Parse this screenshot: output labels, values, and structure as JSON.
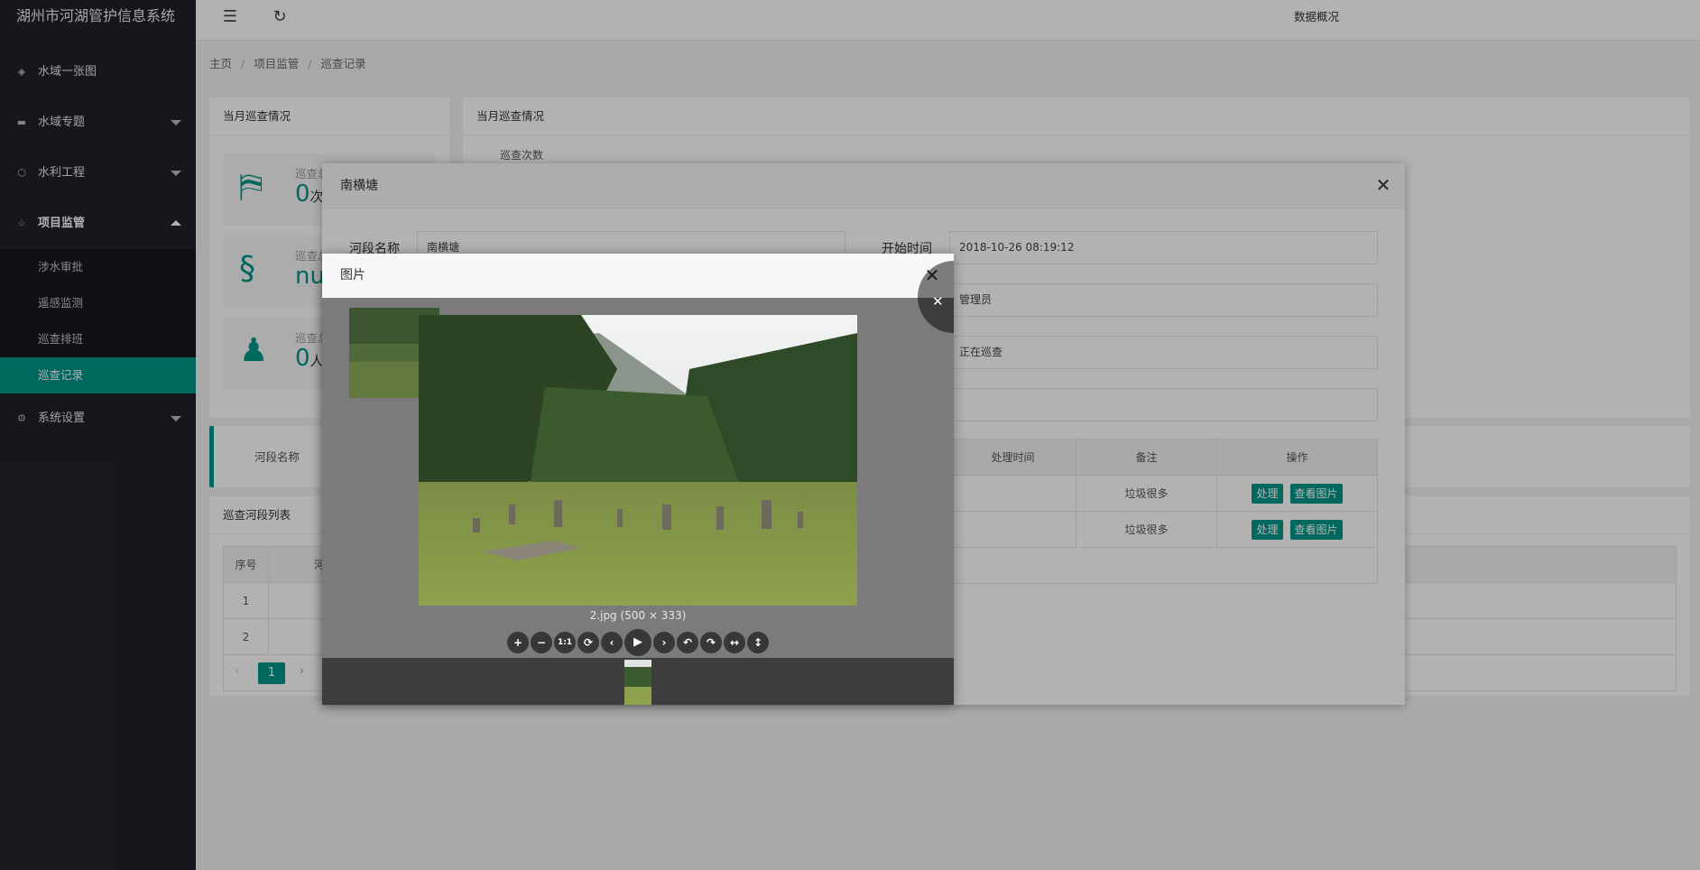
{
  "app": {
    "title": "湖州市河湖管护信息系统"
  },
  "sidebar": {
    "items": [
      {
        "label": "水域一张图",
        "icon": "shield-check-icon"
      },
      {
        "label": "水域专题",
        "icon": "folder-icon"
      },
      {
        "label": "水利工程",
        "icon": "cube-icon"
      },
      {
        "label": "项目监管",
        "icon": "star-icon"
      },
      {
        "label": "系统设置",
        "icon": "gear-icon"
      }
    ],
    "subitems": [
      "涉水审批",
      "遥感监测",
      "巡查排班",
      "巡查记录"
    ]
  },
  "header": {
    "right_link": "数据概况",
    "menu_icon": "menu-fold-icon",
    "refresh_icon": "refresh-icon"
  },
  "breadcrumb": [
    "主页",
    "项目监管",
    "巡查记录"
  ],
  "left_card": {
    "title": "当月巡查情况",
    "stats": [
      {
        "label": "巡查总次数",
        "value": "0",
        "unit": "次",
        "icon": "map-pin-icon"
      },
      {
        "label": "巡查总里程",
        "value": "null",
        "unit": "",
        "icon": "route-icon"
      },
      {
        "label": "巡查总人数",
        "value": "0",
        "unit": "人",
        "icon": "user-icon"
      }
    ]
  },
  "right_card": {
    "title": "当月巡查情况",
    "chart_label": "巡查次数"
  },
  "search": {
    "river_label": "河段名称"
  },
  "list_card": {
    "title": "巡查河段列表",
    "columns": [
      "序号",
      "河"
    ],
    "rows": [
      "1",
      "2"
    ],
    "pagination": {
      "current": "1",
      "prev": "‹",
      "next": "›"
    }
  },
  "detail_dialog": {
    "title": "南横塘",
    "fields": {
      "river_label": "河段名称",
      "river_value": "南横塘",
      "start_label": "开始时间",
      "start_value": "2018-10-26 08:19:12",
      "person_value": "管理员",
      "status_value": "正在巡查"
    },
    "table": {
      "headers": [
        "处理时间",
        "备注",
        "操作"
      ],
      "rows": [
        {
          "remark": "垃圾很多",
          "handle": "处理",
          "view": "查看图片"
        },
        {
          "remark": "垃圾很多",
          "handle": "处理",
          "view": "查看图片"
        }
      ]
    }
  },
  "image_dialog": {
    "title": "图片",
    "caption": "2.jpg (500 × 333)",
    "toolbar": [
      "+",
      "−",
      "1:1",
      "⟳",
      "‹",
      "▶",
      "›",
      "↶",
      "↷",
      "↔",
      "↕"
    ]
  }
}
